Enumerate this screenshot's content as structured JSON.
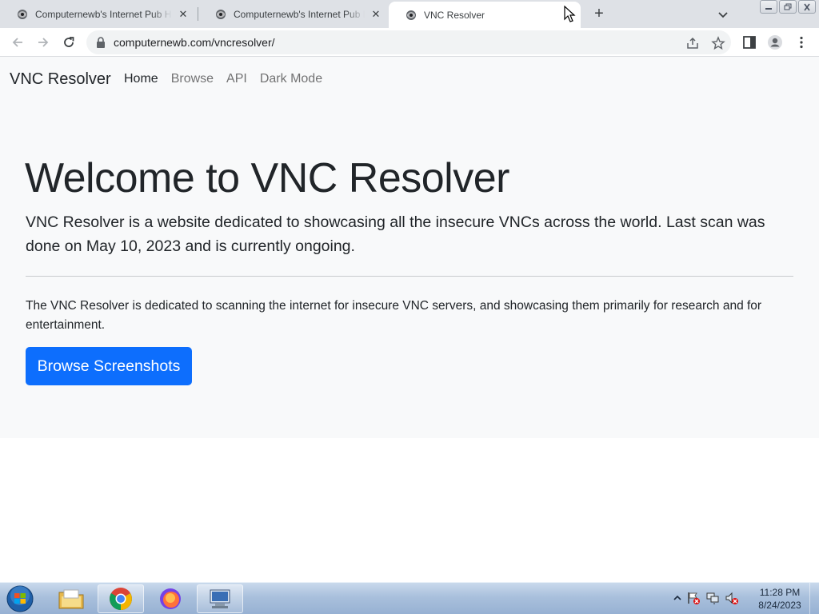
{
  "browser": {
    "tabs": [
      {
        "title": "Computernewb's Internet Pub Hub",
        "close": "✕"
      },
      {
        "title": "Computernewb's Internet Pub Hub",
        "close": "✕"
      },
      {
        "title": "VNC Resolver",
        "close": "✕",
        "active": true
      }
    ],
    "new_tab": "+",
    "url": "computernewb.com/vncresolver/"
  },
  "site": {
    "brand": "VNC Resolver",
    "nav": [
      {
        "label": "Home",
        "active": true
      },
      {
        "label": "Browse"
      },
      {
        "label": "API"
      },
      {
        "label": "Dark Mode"
      }
    ],
    "heading": "Welcome to VNC Resolver",
    "lead": "VNC Resolver is a website dedicated to showcasing all the insecure VNCs across the world. Last scan was done on May 10, 2023 and is currently ongoing.",
    "body": "The VNC Resolver is dedicated to scanning the internet for insecure VNC servers, and showcasing them primarily for research and for entertainment.",
    "button": "Browse Screenshots"
  },
  "taskbar": {
    "apps": [
      "file-explorer",
      "google-chrome",
      "firefox",
      "remote-desktop"
    ],
    "time": "11:28 PM",
    "date": "8/24/2023"
  },
  "colors": {
    "primary": "#0d6efd",
    "light_bg": "#f8f9fa",
    "tab_strip": "#dee1e6"
  }
}
